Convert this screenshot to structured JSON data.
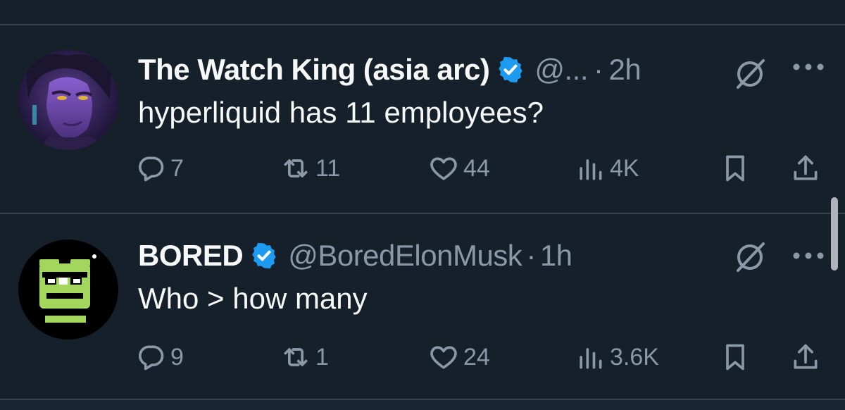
{
  "feed": {
    "tweets": [
      {
        "name": "The Watch King (asia arc)",
        "handle": "@...",
        "separator": "·",
        "time": "2h",
        "text": "hyperliquid has 11 employees?",
        "avatar_icon": "avatar-purple-character",
        "verified": true,
        "replies": "7",
        "reposts": "11",
        "likes": "44",
        "views": "4K"
      },
      {
        "name": "BORED",
        "handle": "@BoredElonMusk",
        "separator": "·",
        "time": "1h",
        "text": "Who > how many",
        "avatar_icon": "avatar-green-frog",
        "verified": true,
        "replies": "9",
        "reposts": "1",
        "likes": "24",
        "views": "3.6K"
      }
    ]
  },
  "colors": {
    "background": "#15202b",
    "divider": "#38444d",
    "text_primary": "#f7f9f9",
    "text_secondary": "#8b98a5",
    "verified_badge": "#1d9bf0"
  },
  "icons": {
    "reply": "reply-icon",
    "repost": "repost-icon",
    "like": "like-icon",
    "views": "views-icon",
    "bookmark": "bookmark-icon",
    "share": "share-icon",
    "grok": "grok-icon",
    "more": "more-icon",
    "verified": "verified-badge-icon"
  }
}
